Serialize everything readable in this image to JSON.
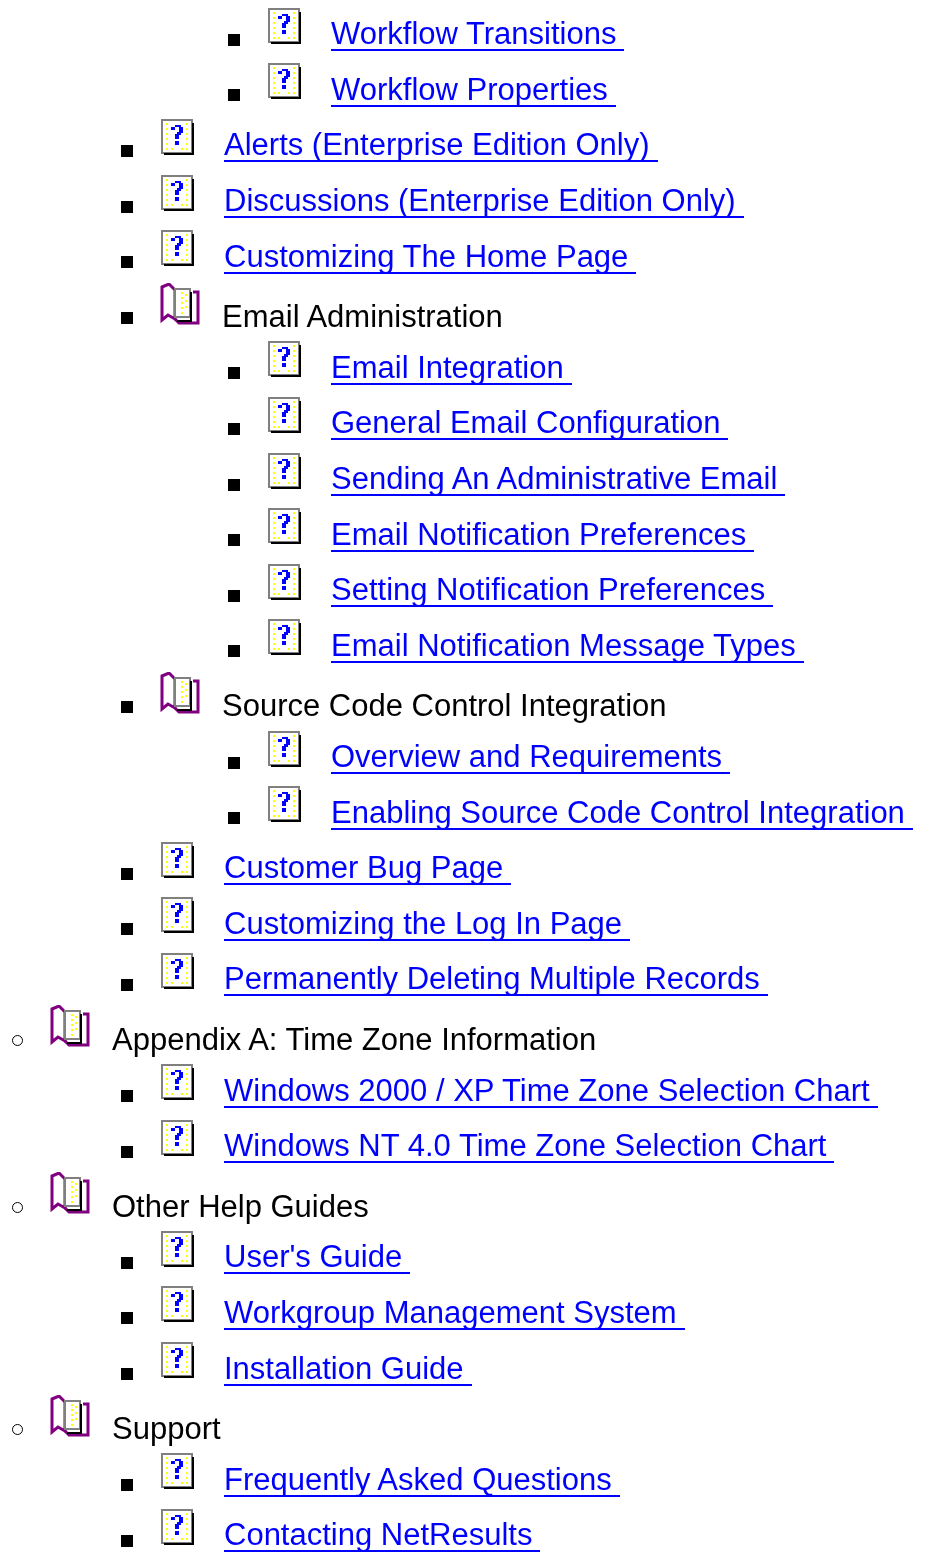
{
  "tree": [
    {
      "children": [
        {
          "children": [
            {
              "kind": "page",
              "label": "Workflow Transitions"
            },
            {
              "kind": "page",
              "label": "Workflow Properties"
            }
          ]
        },
        {
          "kind": "page",
          "label": "Alerts (Enterprise Edition Only)"
        },
        {
          "kind": "page",
          "label": "Discussions (Enterprise Edition Only)"
        },
        {
          "kind": "page",
          "label": "Customizing The Home Page"
        },
        {
          "kind": "book",
          "label": "Email Administration",
          "children": [
            {
              "kind": "page",
              "label": "Email Integration"
            },
            {
              "kind": "page",
              "label": "General Email Configuration"
            },
            {
              "kind": "page",
              "label": "Sending An Administrative Email"
            },
            {
              "kind": "page",
              "label": "Email Notification Preferences"
            },
            {
              "kind": "page",
              "label": "Setting Notification Preferences"
            },
            {
              "kind": "page",
              "label": "Email Notification Message Types"
            }
          ]
        },
        {
          "kind": "book",
          "label": "Source Code Control Integration",
          "children": [
            {
              "kind": "page",
              "label": "Overview and Requirements"
            },
            {
              "kind": "page",
              "label": "Enabling Source Code Control Integration"
            }
          ]
        },
        {
          "kind": "page",
          "label": "Customer Bug Page"
        },
        {
          "kind": "page",
          "label": "Customizing the Log In Page"
        },
        {
          "kind": "page",
          "label": "Permanently Deleting Multiple Records"
        }
      ]
    },
    {
      "kind": "book",
      "label": "Appendix A: Time Zone Information",
      "children": [
        {
          "kind": "page",
          "label": "Windows 2000 / XP Time Zone Selection Chart"
        },
        {
          "kind": "page",
          "label": "Windows NT 4.0 Time Zone Selection Chart"
        }
      ]
    },
    {
      "kind": "book",
      "label": "Other Help Guides",
      "children": [
        {
          "kind": "page",
          "label": "User's Guide"
        },
        {
          "kind": "page",
          "label": "Workgroup Management System"
        },
        {
          "kind": "page",
          "label": "Installation Guide"
        }
      ]
    },
    {
      "kind": "book",
      "label": "Support",
      "children": [
        {
          "kind": "page",
          "label": "Frequently Asked Questions"
        },
        {
          "kind": "page",
          "label": "Contacting NetResults"
        }
      ]
    }
  ]
}
